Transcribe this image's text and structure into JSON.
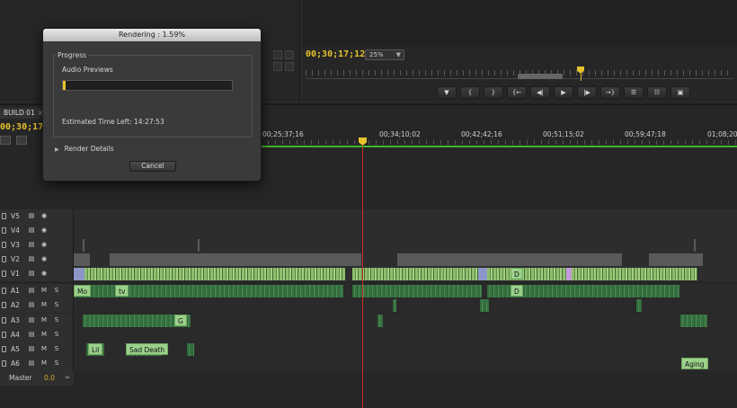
{
  "program_monitor": {
    "timecode": "00;30;17;12",
    "zoom": "25%",
    "transport": [
      {
        "name": "marker-button",
        "glyph": "▼"
      },
      {
        "name": "in-point-button",
        "glyph": "{"
      },
      {
        "name": "out-point-button",
        "glyph": "}"
      },
      {
        "name": "go-to-in-button",
        "glyph": "{←"
      },
      {
        "name": "step-back-button",
        "glyph": "◀|"
      },
      {
        "name": "play-button",
        "glyph": "▶"
      },
      {
        "name": "step-forward-button",
        "glyph": "|▶"
      },
      {
        "name": "go-to-out-button",
        "glyph": "→}"
      },
      {
        "name": "lift-button",
        "glyph": "☰"
      },
      {
        "name": "extract-button",
        "glyph": "☷"
      },
      {
        "name": "export-frame-button",
        "glyph": "▣"
      }
    ]
  },
  "timeline": {
    "sequence_tab": "BUILD 01",
    "tab_close": "×",
    "timecode": "00;30;17;12",
    "ruler_labels": [
      "00;25;37;16",
      "00;34;10;02",
      "00;42;42;16",
      "00;51;15;02",
      "00;59;47;18",
      "01;08;20;"
    ],
    "tracks": [
      {
        "name": "V5",
        "kind": "video"
      },
      {
        "name": "V4",
        "kind": "video"
      },
      {
        "name": "V3",
        "kind": "video"
      },
      {
        "name": "V2",
        "kind": "video"
      },
      {
        "name": "V1",
        "kind": "video"
      },
      {
        "name": "A1",
        "kind": "audio"
      },
      {
        "name": "A2",
        "kind": "audio"
      },
      {
        "name": "A3",
        "kind": "audio"
      },
      {
        "name": "A4",
        "kind": "audio"
      },
      {
        "name": "A5",
        "kind": "audio"
      },
      {
        "name": "A6",
        "kind": "audio"
      }
    ],
    "track_buttons": {
      "mute": "M",
      "solo": "S",
      "film": "▤",
      "eye": "◉"
    },
    "clip_labels": {
      "v1_d": "D",
      "a1_mo": "Mo",
      "a1_tv": "tv",
      "a1_d": "D",
      "a3_g": "G",
      "a5_lil": "Lil",
      "a5_sad_death": "Sad Death",
      "a6_aging": "Aging"
    },
    "master": {
      "label": "Master",
      "value": "0.0",
      "icon": "≈"
    }
  },
  "render_dialog": {
    "title": "Rendering : 1.59%",
    "group_title": "Progress",
    "task_label": "Audio Previews",
    "progress_fraction": 0.0159,
    "time_left": "Estimated Time Left: 14:27:53",
    "details_toggle": "Render Details",
    "details_glyph": "▶",
    "cancel_label": "Cancel"
  },
  "colors": {
    "timecode": "#e7c22c",
    "render_bar": "#42b52e",
    "playhead": "#c2322c",
    "video_clip": "#8fbd6e",
    "audio_clip": "#2f6b3a"
  }
}
